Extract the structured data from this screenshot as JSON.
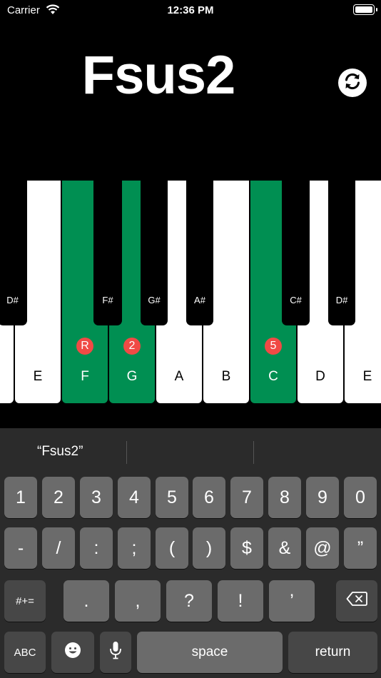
{
  "status_bar": {
    "carrier": "Carrier",
    "time": "12:36 PM"
  },
  "header": {
    "chord": "Fsus2"
  },
  "piano": {
    "white_keys": [
      {
        "label": "",
        "highlighted": false
      },
      {
        "label": "E",
        "highlighted": false
      },
      {
        "label": "F",
        "highlighted": true,
        "badge": "R"
      },
      {
        "label": "G",
        "highlighted": true,
        "badge": "2"
      },
      {
        "label": "A",
        "highlighted": false
      },
      {
        "label": "B",
        "highlighted": false
      },
      {
        "label": "C",
        "highlighted": true,
        "badge": "5"
      },
      {
        "label": "D",
        "highlighted": false
      },
      {
        "label": "E",
        "highlighted": false
      }
    ],
    "black_keys": [
      "D#",
      "F#",
      "G#",
      "A#",
      "C#",
      "D#"
    ],
    "highlight_color": "#008f52",
    "badge_color": "#f04a45"
  },
  "keyboard": {
    "suggestion": "“Fsus2”",
    "row1": [
      "1",
      "2",
      "3",
      "4",
      "5",
      "6",
      "7",
      "8",
      "9",
      "0"
    ],
    "row2": [
      "-",
      "/",
      ":",
      ";",
      "(",
      ")",
      "$",
      "&",
      "@",
      "”"
    ],
    "row3": {
      "mode": "#+=",
      "keys": [
        ".",
        ",",
        "?",
        "!",
        "’"
      ]
    },
    "row4": {
      "abc": "ABC",
      "space": "space",
      "return": "return"
    }
  }
}
